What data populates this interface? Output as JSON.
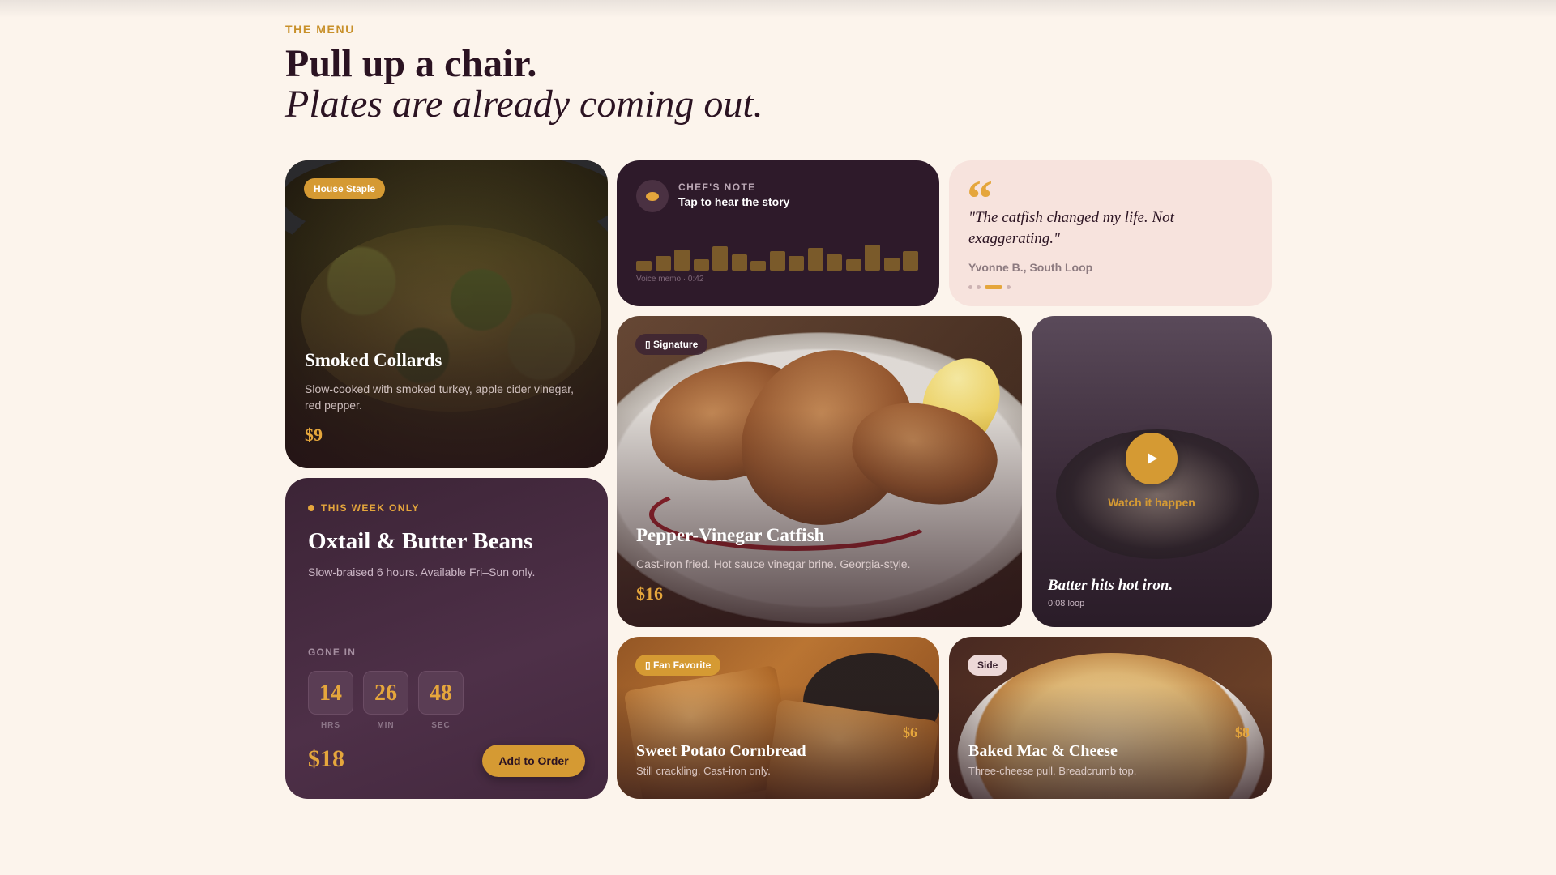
{
  "header": {
    "eyebrow": "THE MENU",
    "title": "Pull up a chair.",
    "subtitle": "Plates are already coming out."
  },
  "collards": {
    "badge": "House Staple",
    "title": "Smoked Collards",
    "desc": "Slow-cooked with smoked turkey, apple cider vinegar, red pepper.",
    "price": "$9"
  },
  "chef_note": {
    "label": "CHEF'S NOTE",
    "action": "Tap to hear the story",
    "memo": "Voice memo · 0:42",
    "icon": "mic-icon"
  },
  "quote": {
    "mark": "“",
    "text": "\"The catfish changed my life. Not exaggerating.\"",
    "author": "Yvonne B., South Loop",
    "slides": 4,
    "active_slide": 3
  },
  "catfish": {
    "badge": "▯ Signature",
    "title": "Pepper-Vinegar Catfish",
    "desc": "Cast-iron fried. Hot sauce vinegar brine. Georgia-style.",
    "price": "$16"
  },
  "video": {
    "watch": "Watch it happen",
    "title": "Batter hits hot iron.",
    "loop": "0:08 loop",
    "icon": "play-icon"
  },
  "oxtail": {
    "flag": "THIS WEEK ONLY",
    "title": "Oxtail & Butter Beans",
    "desc": "Slow-braised 6 hours. Available Fri–Sun only.",
    "gone_label": "GONE IN",
    "hours": "14",
    "minutes": "26",
    "seconds": "48",
    "hours_label": "HRS",
    "minutes_label": "MIN",
    "seconds_label": "SEC",
    "price": "$18",
    "cta": "Add to Order"
  },
  "cornbread": {
    "badge": "▯ Fan Favorite",
    "title": "Sweet Potato Cornbread",
    "desc": "Still crackling. Cast-iron only.",
    "price": "$6"
  },
  "mac": {
    "badge": "Side",
    "title": "Baked Mac & Cheese",
    "desc": "Three-cheese pull. Breadcrumb top.",
    "price": "$8"
  },
  "colors": {
    "background": "#fcf4ec",
    "accent": "#e5a63c",
    "plum": "#2e1a2a"
  }
}
